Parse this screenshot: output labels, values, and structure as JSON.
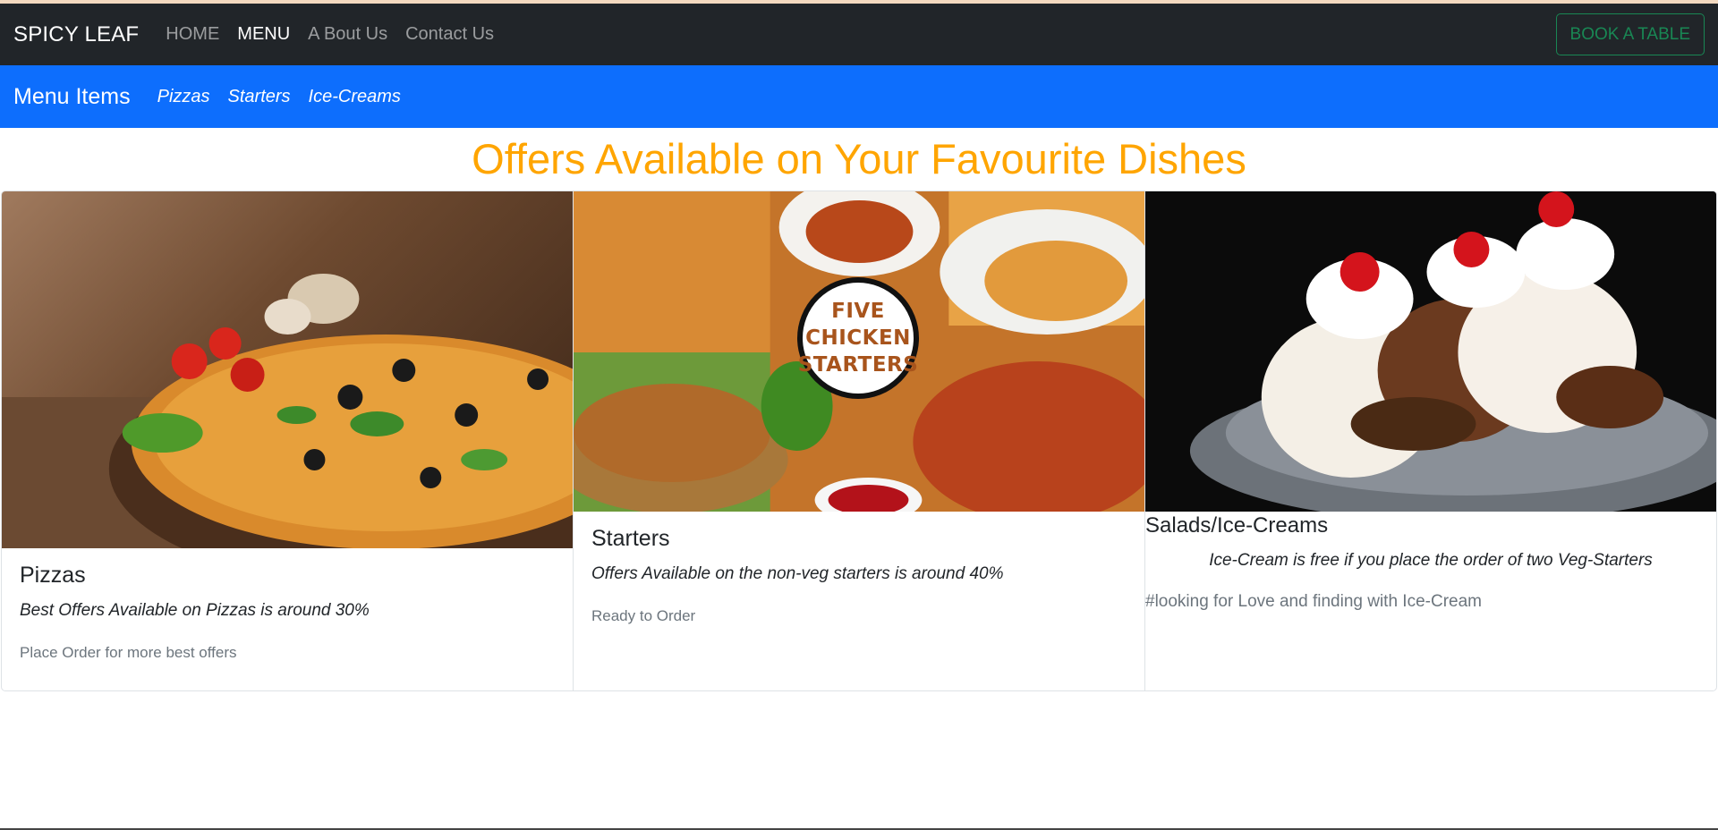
{
  "navbar": {
    "brand": "SPICY LEAF",
    "links": [
      "HOME",
      "MENU",
      "A Bout Us",
      "Contact Us"
    ],
    "book_button": "BOOK A TABLE"
  },
  "subnav": {
    "title": "Menu Items",
    "links": [
      "Pizzas",
      "Starters",
      "Ice-Creams"
    ]
  },
  "heading": "Offers Available on Your Favourite Dishes",
  "cards": [
    {
      "title": "Pizzas",
      "text": "Best Offers Available on Pizzas is around 30%",
      "note": "Place Order for more best offers"
    },
    {
      "title": "Starters",
      "text": "Offers Available on the non-veg starters is around 40%",
      "note": "Ready to Order",
      "image_badge": [
        "FIVE",
        "CHICKEN",
        "STARTERS"
      ]
    },
    {
      "title": "Salads/Ice-Creams",
      "text": "Ice-Cream is free if you place the order of two Veg-Starters",
      "note": "#looking for Love and finding with Ice-Cream"
    }
  ],
  "colors": {
    "navbar_bg": "#212529",
    "subnav_bg": "#0d6efd",
    "heading": "#ffa500",
    "book_button": "#198754"
  }
}
